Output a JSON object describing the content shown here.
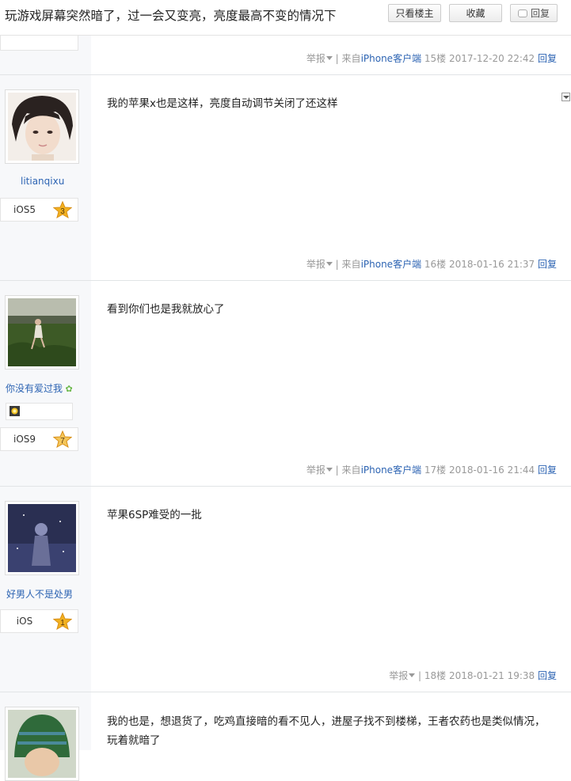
{
  "header": {
    "title": "玩游戏屏幕突然暗了，过一会又变亮，亮度最高不变的情况下",
    "author_only_label": "只看楼主",
    "collect_label": "收藏",
    "reply_label": "回复"
  },
  "labels": {
    "report": "举报",
    "from_prefix": "来自",
    "client": "iPhone客户端",
    "reply": "回复",
    "sep": "|"
  },
  "posts": [
    {
      "floor": "15楼",
      "time": "2017-12-20 22:42"
    },
    {
      "username": "litianqixu",
      "badge": "iOS5",
      "level": "3",
      "content": "我的苹果x也是这样，亮度自动调节关闭了还这样",
      "floor": "16楼",
      "time": "2018-01-16 21:37"
    },
    {
      "username": "你没有爱过我",
      "badge": "iOS9",
      "level": "7",
      "content": "看到你们也是我就放心了",
      "floor": "17楼",
      "time": "2018-01-16 21:44"
    },
    {
      "username": "好男人不是处男",
      "badge": "iOS",
      "level": "1",
      "content": "苹果6SP难受的一批",
      "floor": "18楼",
      "time": "2018-01-21 19:38"
    },
    {
      "content": "我的也是，想退货了，吃鸡直接暗的看不见人，进屋子找不到楼梯，王者农药也是类似情况，玩着就暗了"
    }
  ],
  "colors": {
    "link": "#2d64b3",
    "meta": "#999999",
    "sidebar": "#f7f8fa",
    "star": "#f2b11f"
  },
  "icons": [
    "comment-bubble-icon",
    "dropdown-triangle-icon",
    "level-star-icon",
    "sprout-icon",
    "medal-icon",
    "collapse-icon"
  ]
}
